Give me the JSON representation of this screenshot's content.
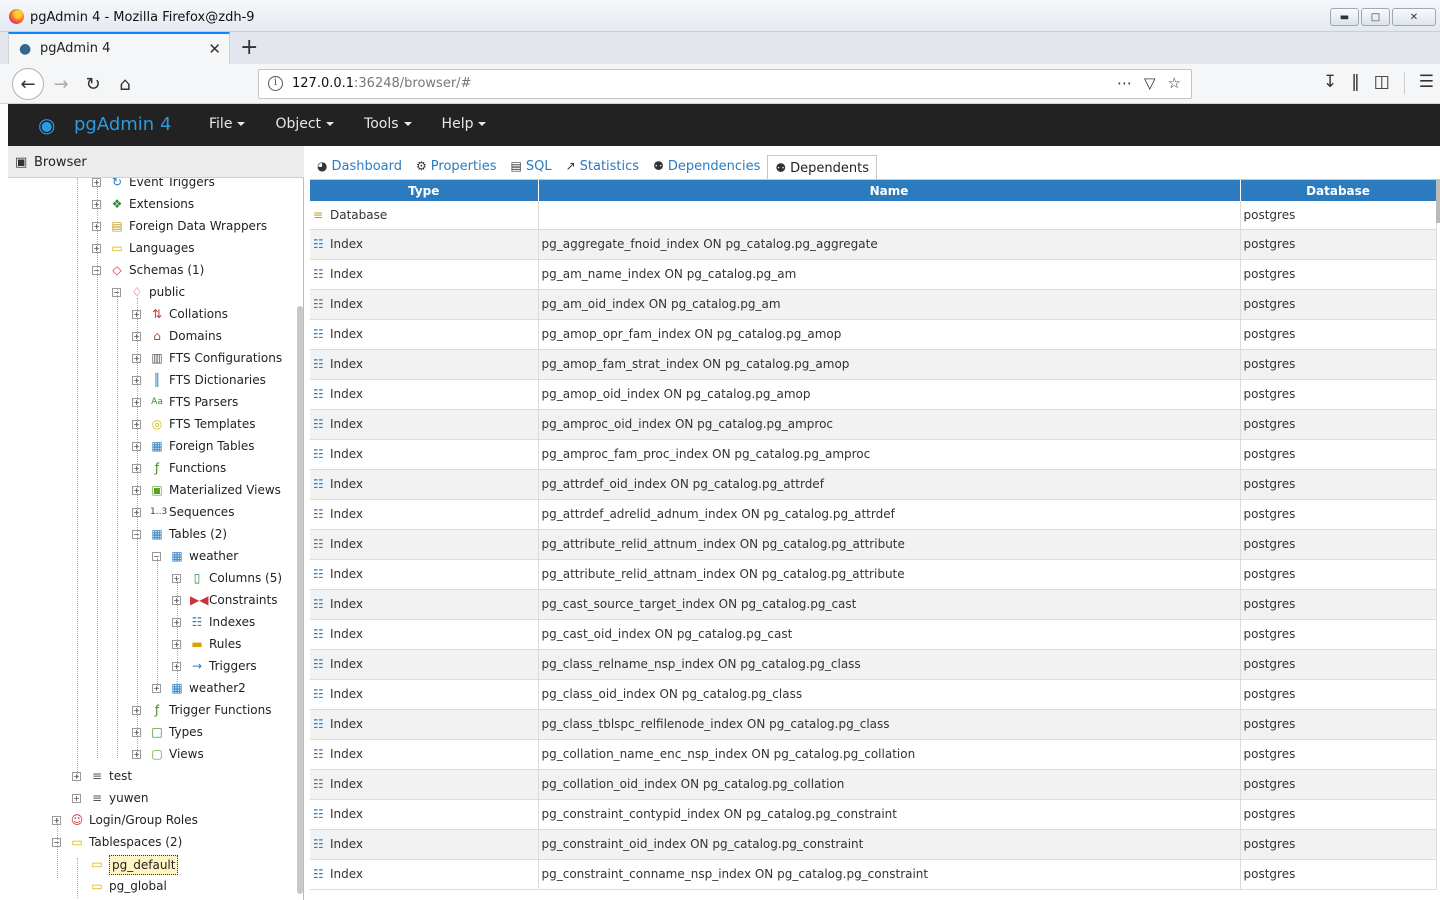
{
  "window": {
    "title": "pgAdmin 4 - Mozilla Firefox@zdh-9"
  },
  "browser_tab": {
    "label": "pgAdmin 4"
  },
  "address": {
    "host": "127.0.0.1",
    "rest": ":36248/browser/#"
  },
  "app": {
    "title": "pgAdmin 4",
    "menu": [
      "File",
      "Tools",
      "Help"
    ],
    "menu_object": "Object"
  },
  "browser_panel": {
    "label": "Browser",
    "nodes": [
      {
        "label": "Event Triggers",
        "icon": "event-trigger-icon",
        "level": 4
      },
      {
        "label": "Extensions",
        "icon": "extensions-icon",
        "level": 4
      },
      {
        "label": "Foreign Data Wrappers",
        "icon": "fdw-icon",
        "level": 4
      },
      {
        "label": "Languages",
        "icon": "languages-icon",
        "level": 4
      },
      {
        "label": "Schemas (1)",
        "icon": "schemas-icon",
        "level": 4,
        "open": true
      },
      {
        "label": "public",
        "icon": "schema-icon",
        "level": 5,
        "open": true
      },
      {
        "label": "Collations",
        "icon": "collations-icon",
        "level": 6
      },
      {
        "label": "Domains",
        "icon": "domains-icon",
        "level": 6
      },
      {
        "label": "FTS Configurations",
        "icon": "fts-config-icon",
        "level": 6
      },
      {
        "label": "FTS Dictionaries",
        "icon": "fts-dict-icon",
        "level": 6
      },
      {
        "label": "FTS Parsers",
        "icon": "fts-parser-icon",
        "level": 6
      },
      {
        "label": "FTS Templates",
        "icon": "fts-template-icon",
        "level": 6
      },
      {
        "label": "Foreign Tables",
        "icon": "foreign-table-icon",
        "level": 6
      },
      {
        "label": "Functions",
        "icon": "functions-icon",
        "level": 6
      },
      {
        "label": "Materialized Views",
        "icon": "mview-icon",
        "level": 6
      },
      {
        "label": "Sequences",
        "icon": "sequences-icon",
        "level": 6
      },
      {
        "label": "Tables (2)",
        "icon": "tables-icon",
        "level": 6,
        "open": true
      },
      {
        "label": "weather",
        "icon": "table-icon",
        "level": 7,
        "open": true
      },
      {
        "label": "Columns (5)",
        "icon": "columns-icon",
        "level": 8
      },
      {
        "label": "Constraints",
        "icon": "constraints-icon",
        "level": 8
      },
      {
        "label": "Indexes",
        "icon": "indexes-icon",
        "level": 8
      },
      {
        "label": "Rules",
        "icon": "rules-icon",
        "level": 8
      },
      {
        "label": "Triggers",
        "icon": "triggers-icon",
        "level": 8
      },
      {
        "label": "weather2",
        "icon": "table-icon",
        "level": 7
      },
      {
        "label": "Trigger Functions",
        "icon": "trigger-functions-icon",
        "level": 6
      },
      {
        "label": "Types",
        "icon": "types-icon",
        "level": 6
      },
      {
        "label": "Views",
        "icon": "views-icon",
        "level": 6
      },
      {
        "label": "test",
        "icon": "database-icon",
        "level": 3
      },
      {
        "label": "yuwen",
        "icon": "database-icon",
        "level": 3
      },
      {
        "label": "Login/Group Roles",
        "icon": "roles-icon",
        "level": 2
      },
      {
        "label": "Tablespaces (2)",
        "icon": "tablespaces-icon",
        "level": 2,
        "open": true
      },
      {
        "label": "pg_default",
        "icon": "tablespace-icon",
        "level": 3,
        "leaf": true,
        "selected": true
      },
      {
        "label": "pg_global",
        "icon": "tablespace-icon",
        "level": 3,
        "leaf": true
      }
    ]
  },
  "main_tabs": [
    {
      "label": "Dashboard",
      "icon": "dashboard-icon"
    },
    {
      "label": "Properties",
      "icon": "properties-icon"
    },
    {
      "label": "SQL",
      "icon": "sql-icon"
    },
    {
      "label": "Statistics",
      "icon": "statistics-icon"
    },
    {
      "label": "Dependencies",
      "icon": "dependencies-icon"
    },
    {
      "label": "Dependents",
      "icon": "dependents-icon",
      "active": true
    }
  ],
  "grid": {
    "columns": [
      "Type",
      "Name",
      "Database"
    ],
    "rows": [
      [
        "Database",
        "",
        "postgres"
      ],
      [
        "Index",
        "pg_aggregate_fnoid_index ON pg_catalog.pg_aggregate",
        "postgres"
      ],
      [
        "Index",
        "pg_am_name_index ON pg_catalog.pg_am",
        "postgres"
      ],
      [
        "Index",
        "pg_am_oid_index ON pg_catalog.pg_am",
        "postgres"
      ],
      [
        "Index",
        "pg_amop_opr_fam_index ON pg_catalog.pg_amop",
        "postgres"
      ],
      [
        "Index",
        "pg_amop_fam_strat_index ON pg_catalog.pg_amop",
        "postgres"
      ],
      [
        "Index",
        "pg_amop_oid_index ON pg_catalog.pg_amop",
        "postgres"
      ],
      [
        "Index",
        "pg_amproc_oid_index ON pg_catalog.pg_amproc",
        "postgres"
      ],
      [
        "Index",
        "pg_amproc_fam_proc_index ON pg_catalog.pg_amproc",
        "postgres"
      ],
      [
        "Index",
        "pg_attrdef_oid_index ON pg_catalog.pg_attrdef",
        "postgres"
      ],
      [
        "Index",
        "pg_attrdef_adrelid_adnum_index ON pg_catalog.pg_attrdef",
        "postgres"
      ],
      [
        "Index",
        "pg_attribute_relid_attnum_index ON pg_catalog.pg_attribute",
        "postgres"
      ],
      [
        "Index",
        "pg_attribute_relid_attnam_index ON pg_catalog.pg_attribute",
        "postgres"
      ],
      [
        "Index",
        "pg_cast_source_target_index ON pg_catalog.pg_cast",
        "postgres"
      ],
      [
        "Index",
        "pg_cast_oid_index ON pg_catalog.pg_cast",
        "postgres"
      ],
      [
        "Index",
        "pg_class_relname_nsp_index ON pg_catalog.pg_class",
        "postgres"
      ],
      [
        "Index",
        "pg_class_oid_index ON pg_catalog.pg_class",
        "postgres"
      ],
      [
        "Index",
        "pg_class_tblspc_relfilenode_index ON pg_catalog.pg_class",
        "postgres"
      ],
      [
        "Index",
        "pg_collation_name_enc_nsp_index ON pg_catalog.pg_collation",
        "postgres"
      ],
      [
        "Index",
        "pg_collation_oid_index ON pg_catalog.pg_collation",
        "postgres"
      ],
      [
        "Index",
        "pg_constraint_contypid_index ON pg_catalog.pg_constraint",
        "postgres"
      ],
      [
        "Index",
        "pg_constraint_oid_index ON pg_catalog.pg_constraint",
        "postgres"
      ],
      [
        "Index",
        "pg_constraint_conname_nsp_index ON pg_catalog.pg_constraint",
        "postgres"
      ]
    ]
  },
  "colors": {
    "accent": "#2c7bbf",
    "header_bg": "#222222",
    "logo": "#2c9ae0"
  }
}
